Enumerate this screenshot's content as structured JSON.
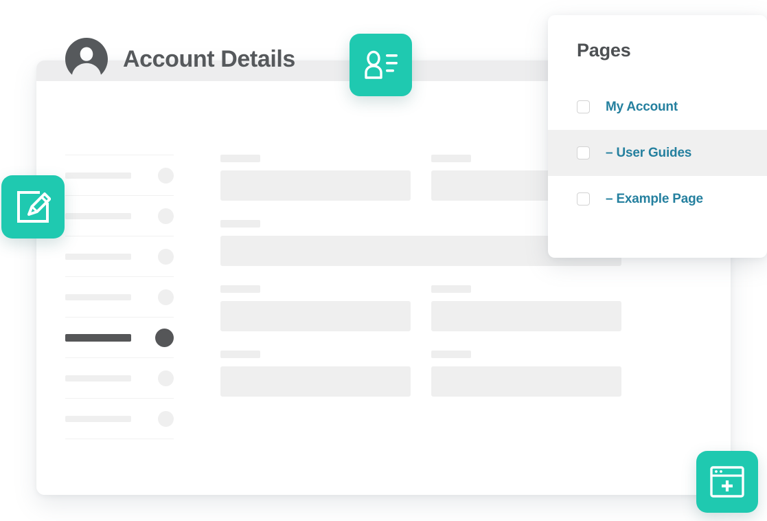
{
  "app_window": {
    "title": "Account Details",
    "avatar_icon": "user-avatar-icon",
    "left_list": {
      "rows": [
        {
          "state": "idle"
        },
        {
          "state": "idle"
        },
        {
          "state": "idle"
        },
        {
          "state": "idle"
        },
        {
          "state": "active"
        },
        {
          "state": "idle"
        },
        {
          "state": "idle"
        }
      ]
    },
    "form_rows": [
      {
        "fields": [
          "half",
          "half"
        ]
      },
      {
        "fields": [
          "full"
        ]
      },
      {
        "fields": [
          "half",
          "half"
        ]
      },
      {
        "fields": [
          "half",
          "half"
        ]
      }
    ]
  },
  "pages_panel": {
    "title": "Pages",
    "items": [
      {
        "label": "My Account",
        "checked": false,
        "hovered": false
      },
      {
        "label": "– User Guides",
        "checked": false,
        "hovered": true
      },
      {
        "label": "– Example Page",
        "checked": false,
        "hovered": false
      }
    ]
  },
  "floating_icons": [
    {
      "name": "contact-card-icon",
      "position": "top-center"
    },
    {
      "name": "edit-pencil-icon",
      "position": "left-middle"
    },
    {
      "name": "new-page-icon",
      "position": "bottom-right"
    }
  ],
  "colors": {
    "teal": "#1FC9B0",
    "link_blue": "#25809F",
    "title_gray": "#56595C",
    "skeleton_gray": "#EFEFEF",
    "active_dark": "#555658",
    "row_hover": "#F0F0F0"
  }
}
